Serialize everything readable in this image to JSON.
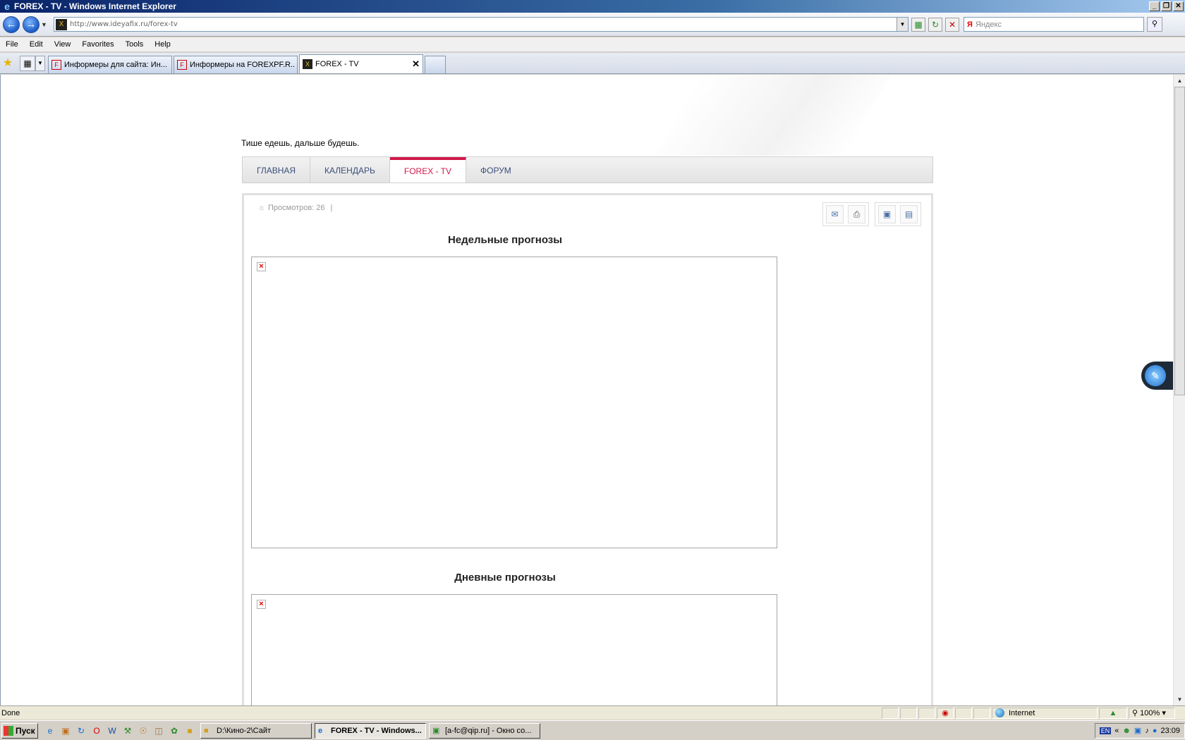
{
  "window": {
    "title": "FOREX - TV - Windows Internet Explorer",
    "minimize": "_",
    "restore": "❐",
    "close": "✕"
  },
  "address": {
    "url": "http://www.ideyafix.ru/forex-tv",
    "search_placeholder": "Яндекс"
  },
  "menu": [
    "File",
    "Edit",
    "View",
    "Favorites",
    "Tools",
    "Help"
  ],
  "tabs": [
    {
      "label": "Информеры для сайта: Ин...",
      "icon": "F"
    },
    {
      "label": "Информеры на FOREXPF.R...",
      "icon": "F"
    },
    {
      "label": "FOREX - TV",
      "icon": "X",
      "close": "✕"
    }
  ],
  "page": {
    "slogan": "Тише едешь, дальше будешь.",
    "nav": [
      "ГЛАВНАЯ",
      "КАЛЕНДАРЬ",
      "FOREX - TV",
      "ФОРУМ"
    ],
    "active_nav": "FOREX - TV",
    "views": "Просмотров: 26",
    "views_sep": "|",
    "section1_title": "Недельные прогнозы",
    "section2_title": "Дневные прогнозы",
    "broken_image_glyph": "×"
  },
  "status": {
    "text": "Done",
    "zone": "Internet",
    "zoom": "100%",
    "zoom_dd": "▾"
  },
  "taskbar": {
    "start": "Пуск",
    "tasks": [
      {
        "label": "D:\\Кино-2\\Сайт",
        "icon": "folder-icon"
      },
      {
        "label": "FOREX - TV - Windows...",
        "icon": "ie-icon"
      },
      {
        "label": "[a-fc@qip.ru] - Окно со...",
        "icon": "qip-icon"
      }
    ],
    "lang": "EN",
    "clock": "23:09",
    "tray_arrows": "«"
  },
  "colors": {
    "accent": "#d0184a",
    "nav_text": "#3a4e7a",
    "titlebar": "#0a246a"
  }
}
